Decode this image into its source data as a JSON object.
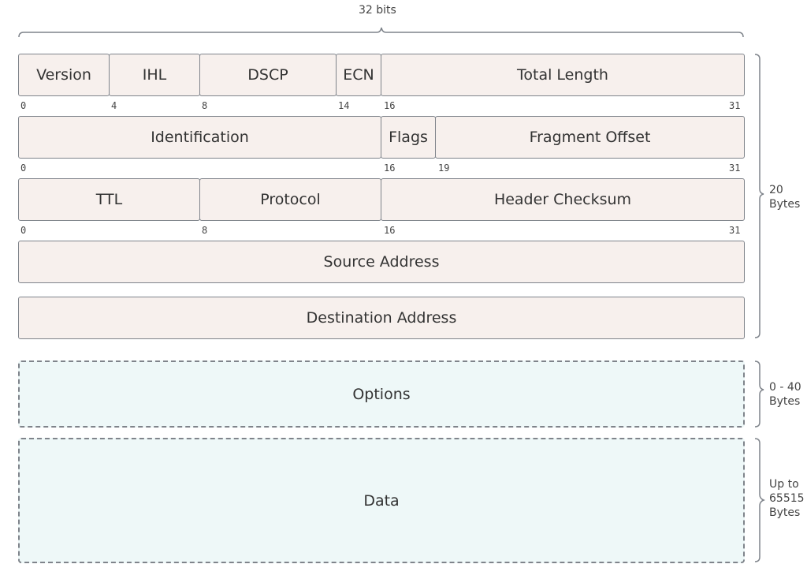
{
  "header": {
    "width_label": "32 bits"
  },
  "rows": [
    {
      "fields": [
        {
          "name": "version",
          "label": "Version"
        },
        {
          "name": "ihl",
          "label": "IHL"
        },
        {
          "name": "dscp",
          "label": "DSCP"
        },
        {
          "name": "ecn",
          "label": "ECN"
        },
        {
          "name": "total-length",
          "label": "Total Length"
        }
      ],
      "ticks": [
        "0",
        "4",
        "8",
        "14",
        "16",
        "31"
      ]
    },
    {
      "fields": [
        {
          "name": "identification",
          "label": "Identification"
        },
        {
          "name": "flags",
          "label": "Flags"
        },
        {
          "name": "fragment-offset",
          "label": "Fragment Offset"
        }
      ],
      "ticks": [
        "0",
        "16",
        "19",
        "31"
      ]
    },
    {
      "fields": [
        {
          "name": "ttl",
          "label": "TTL"
        },
        {
          "name": "protocol",
          "label": "Protocol"
        },
        {
          "name": "header-checksum",
          "label": "Header Checksum"
        }
      ],
      "ticks": [
        "0",
        "8",
        "16",
        "31"
      ]
    },
    {
      "fields": [
        {
          "name": "source-address",
          "label": "Source Address"
        }
      ]
    },
    {
      "fields": [
        {
          "name": "destination-address",
          "label": "Destination Address"
        }
      ]
    }
  ],
  "options": {
    "label": "Options"
  },
  "data": {
    "label": "Data"
  },
  "side_labels": {
    "header": [
      "20",
      "Bytes"
    ],
    "options": [
      "0 - 40",
      "Bytes"
    ],
    "data": [
      "Up to",
      "65515",
      "Bytes"
    ]
  }
}
